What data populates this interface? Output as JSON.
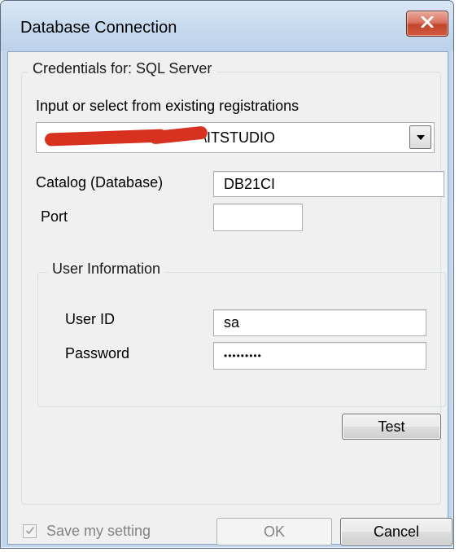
{
  "window": {
    "title": "Database Connection"
  },
  "credentials": {
    "legend": "Credentials for: SQL Server",
    "registration_label": "Input or select from existing registrations",
    "registration_value": "\\ITSTUDIO",
    "catalog_label": "Catalog (Database)",
    "catalog_value": "DB21CI",
    "port_label": "Port",
    "port_value": ""
  },
  "user_info": {
    "legend": "User Information",
    "user_id_label": "User ID",
    "user_id_value": "sa",
    "password_label": "Password",
    "password_value": "•••••••••"
  },
  "buttons": {
    "test": "Test",
    "ok": "OK",
    "cancel": "Cancel"
  },
  "save_setting": {
    "label": "Save my setting",
    "checked": true,
    "disabled": true
  },
  "icons": {
    "close": "close-icon",
    "dropdown": "chevron-down-icon",
    "check": "checkmark-icon"
  },
  "colors": {
    "title_bar": "#c6d9ee",
    "close_button": "#c7503a",
    "redaction": "#d9311f",
    "dialog_bg": "#f0f0f0"
  }
}
